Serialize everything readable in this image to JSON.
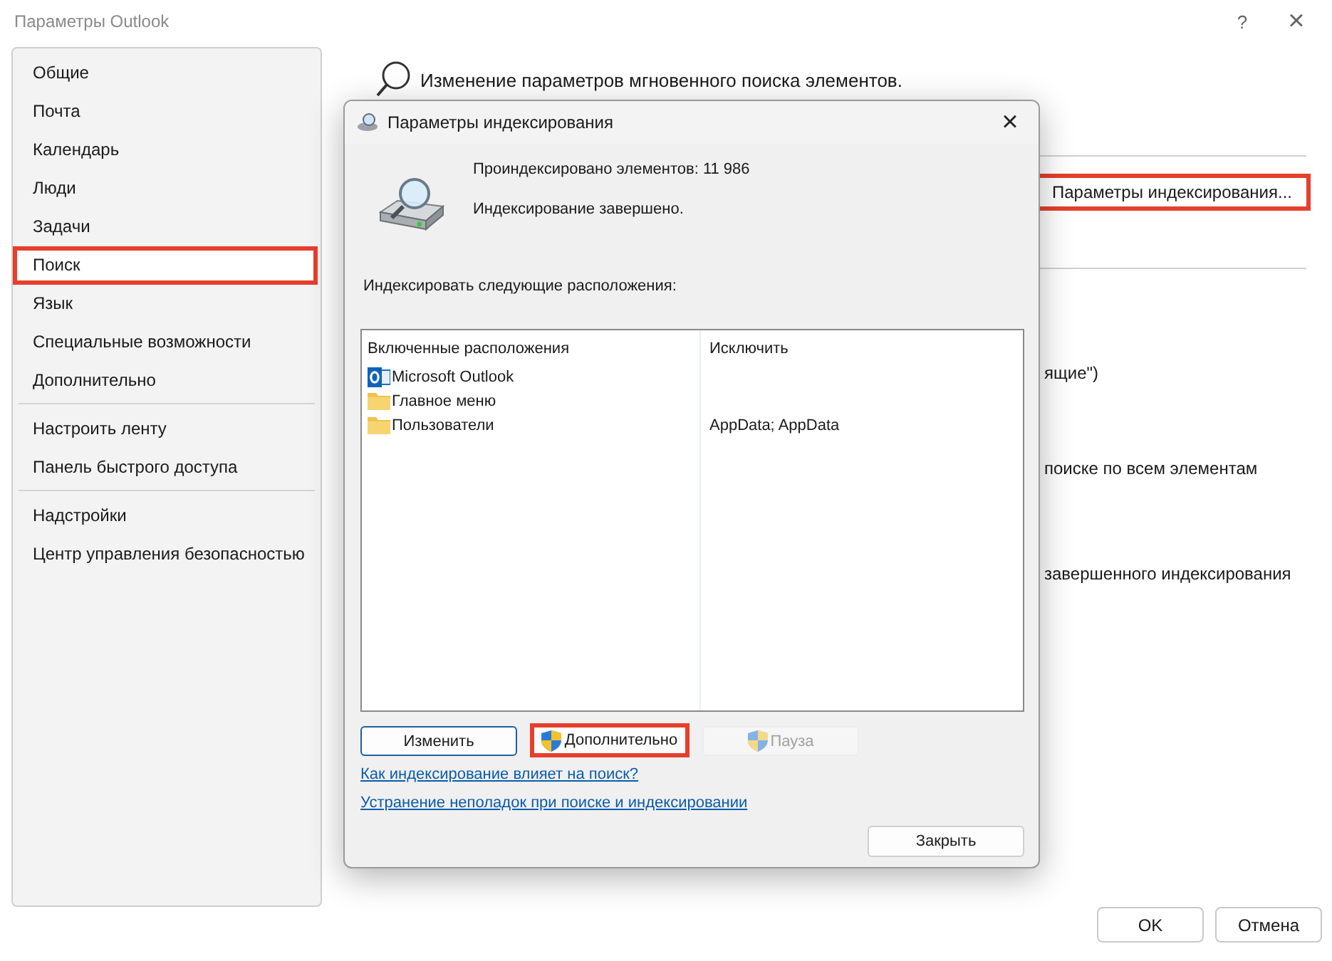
{
  "window": {
    "title": "Параметры Outlook",
    "help_button": "?",
    "close_button": "×"
  },
  "sidebar": {
    "sections": [
      {
        "items": [
          {
            "label": "Общие",
            "selected": false,
            "highlighted": false
          },
          {
            "label": "Почта",
            "selected": false,
            "highlighted": false
          },
          {
            "label": "Календарь",
            "selected": false,
            "highlighted": false
          },
          {
            "label": "Люди",
            "selected": false,
            "highlighted": false
          },
          {
            "label": "Задачи",
            "selected": false,
            "highlighted": false
          },
          {
            "label": "Поиск",
            "selected": true,
            "highlighted": true
          },
          {
            "label": "Язык",
            "selected": false,
            "highlighted": false
          },
          {
            "label": "Специальные возможности",
            "selected": false,
            "highlighted": false
          },
          {
            "label": "Дополнительно",
            "selected": false,
            "highlighted": false
          }
        ]
      },
      {
        "items": [
          {
            "label": "Настроить ленту",
            "selected": false,
            "highlighted": false
          },
          {
            "label": "Панель быстрого доступа",
            "selected": false,
            "highlighted": false
          }
        ]
      },
      {
        "items": [
          {
            "label": "Надстройки",
            "selected": false,
            "highlighted": false
          },
          {
            "label": "Центр управления безопасностью",
            "selected": false,
            "highlighted": false
          }
        ]
      }
    ]
  },
  "main": {
    "heading": "Изменение параметров мгновенного поиска элементов.",
    "index_options_button": {
      "label": "Параметры индексирования...",
      "highlighted": true
    },
    "partial_texts": [
      "ящие\")",
      "поиске по всем элементам",
      "завершенного индексирования"
    ]
  },
  "dialog": {
    "title": "Параметры индексирования",
    "close_button": "×",
    "indexed_count": "Проиндексировано элементов: 11 986",
    "status": "Индексирование завершено.",
    "locations_label": "Индексировать следующие расположения:",
    "table": {
      "columns": [
        "Включенные расположения",
        "Исключить"
      ],
      "rows": [
        {
          "name": "Microsoft Outlook",
          "kind": "outlook",
          "exclude": ""
        },
        {
          "name": "Главное меню",
          "kind": "folder",
          "exclude": ""
        },
        {
          "name": "Пользователи",
          "kind": "folder",
          "exclude": "AppData; AppData"
        }
      ]
    },
    "buttons": [
      {
        "label": "Изменить",
        "shield": false,
        "default": true,
        "disabled": false,
        "highlighted": false
      },
      {
        "label": "Дополнительно",
        "shield": true,
        "default": false,
        "disabled": false,
        "highlighted": true
      },
      {
        "label": "Пауза",
        "shield": true,
        "default": false,
        "disabled": true,
        "highlighted": false
      }
    ],
    "links": [
      "Как индексирование влияет на поиск?",
      "Устранение неполадок при поиске и индексировании"
    ],
    "close_label": "Закрыть"
  },
  "footer_buttons": [
    "OK",
    "Отмена"
  ]
}
